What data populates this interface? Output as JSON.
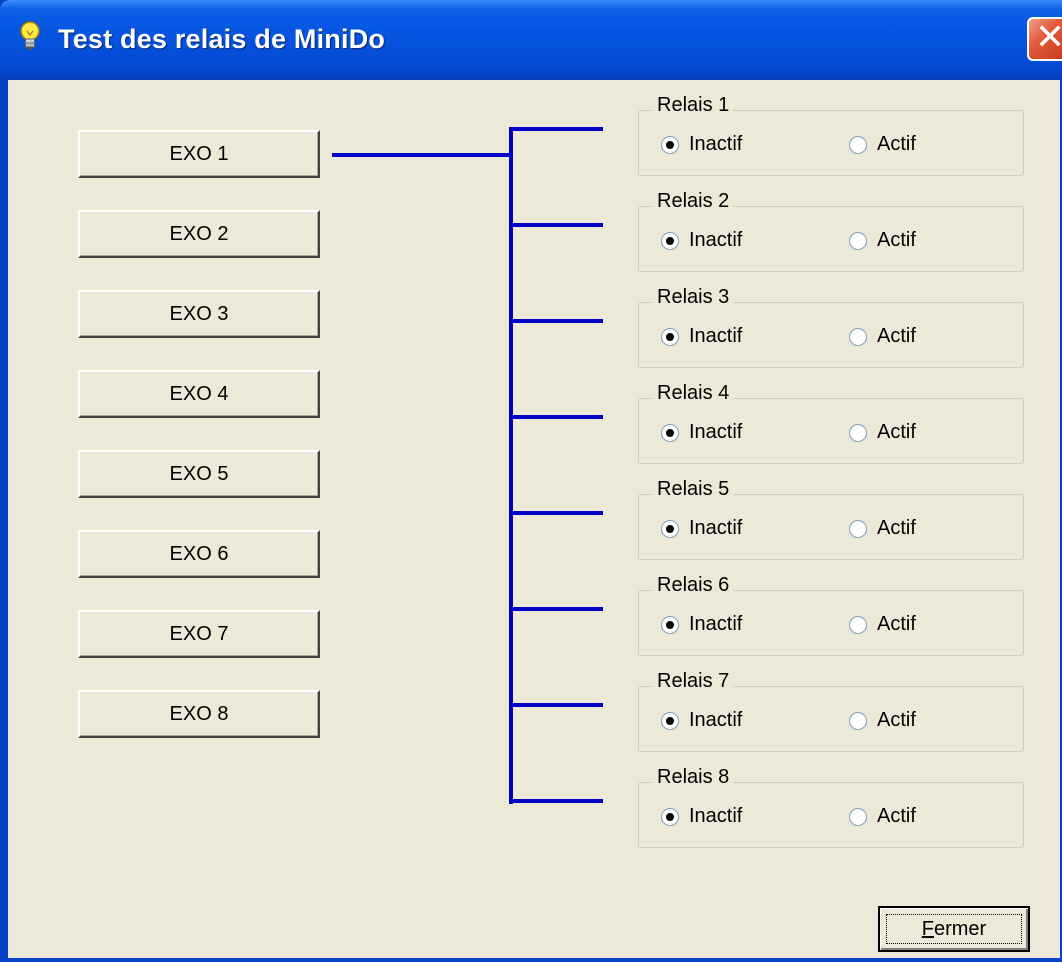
{
  "window": {
    "title": "Test des relais de MiniDo",
    "icon": "lightbulb-icon",
    "close_glyph": "✕"
  },
  "colors": {
    "titlebar": "#0654e0",
    "background": "#ece9d8",
    "bus_line": "#0000c8",
    "close_red": "#e3573a"
  },
  "exo_buttons": [
    {
      "label": "EXO 1"
    },
    {
      "label": "EXO 2"
    },
    {
      "label": "EXO 3"
    },
    {
      "label": "EXO 4"
    },
    {
      "label": "EXO 5"
    },
    {
      "label": "EXO 6"
    },
    {
      "label": "EXO 7"
    },
    {
      "label": "EXO 8"
    }
  ],
  "selected_exo": "EXO 1",
  "relays": [
    {
      "label": "Relais 1",
      "options": [
        "Inactif",
        "Actif"
      ],
      "selected": "Inactif"
    },
    {
      "label": "Relais 2",
      "options": [
        "Inactif",
        "Actif"
      ],
      "selected": "Inactif"
    },
    {
      "label": "Relais 3",
      "options": [
        "Inactif",
        "Actif"
      ],
      "selected": "Inactif"
    },
    {
      "label": "Relais 4",
      "options": [
        "Inactif",
        "Actif"
      ],
      "selected": "Inactif"
    },
    {
      "label": "Relais 5",
      "options": [
        "Inactif",
        "Actif"
      ],
      "selected": "Inactif"
    },
    {
      "label": "Relais 6",
      "options": [
        "Inactif",
        "Actif"
      ],
      "selected": "Inactif"
    },
    {
      "label": "Relais 7",
      "options": [
        "Inactif",
        "Actif"
      ],
      "selected": "Inactif"
    },
    {
      "label": "Relais 8",
      "options": [
        "Inactif",
        "Actif"
      ],
      "selected": "Inactif"
    }
  ],
  "footer": {
    "close_button": {
      "label_first": "F",
      "label_rest": "ermer"
    }
  }
}
